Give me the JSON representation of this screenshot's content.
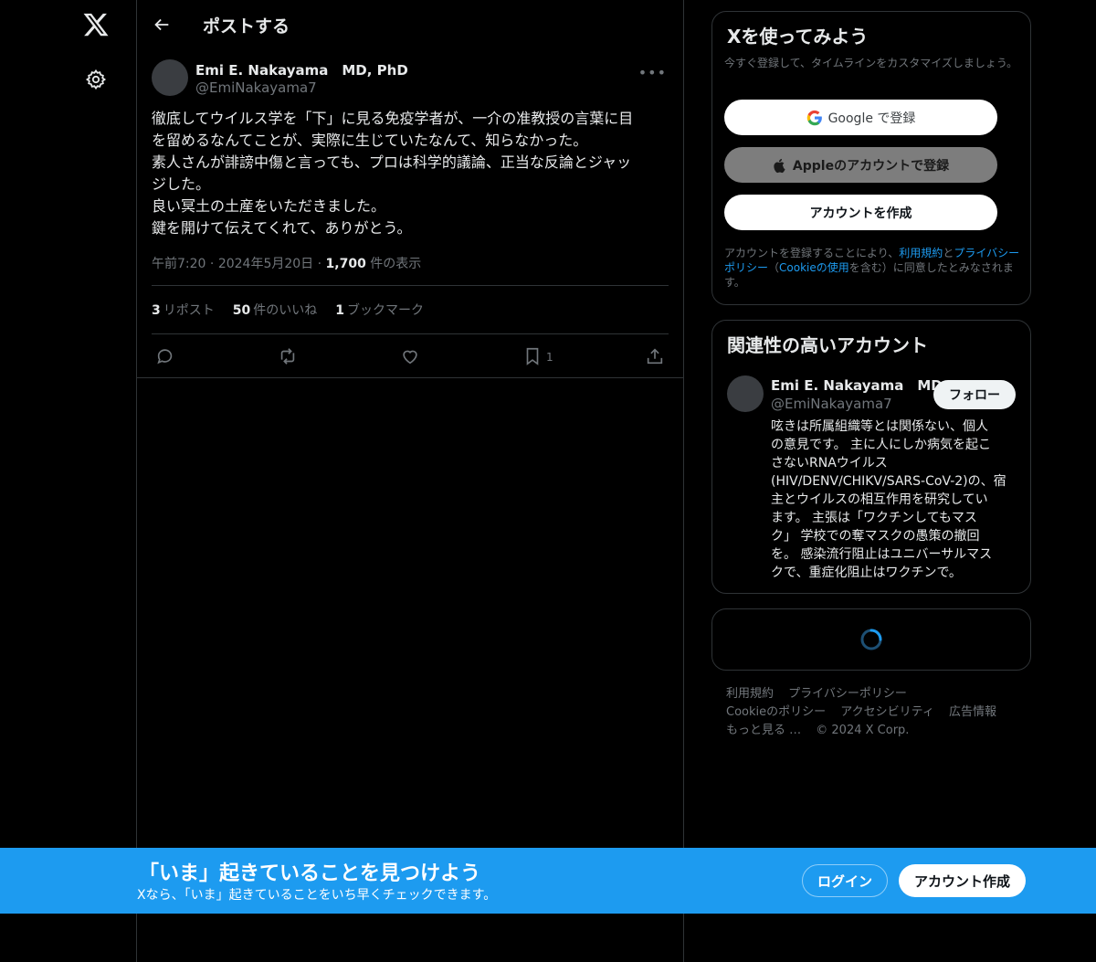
{
  "header": {
    "title": "ポストする"
  },
  "post": {
    "author_name": "Emi E. Nakayama　MD, PhD",
    "author_handle": "@EmiNakayama7",
    "more_label": "•••",
    "lines": [
      "徹底してウイルス学を「下」に見る免疫学者が、一介の准教授の言葉に目",
      "を留めるなんてことが、実際に生じていたなんて、知らなかった。",
      "素人さんが誹謗中傷と言っても、プロは科学的議論、正当な反論とジャッ",
      "ジした。",
      "良い冥土の土産をいただきました。",
      "鍵を開けて伝えてくれて、ありがとう。"
    ],
    "time": "午前7:20",
    "date": "2024年5月20日",
    "views_count": "1,700",
    "views_label": "件の表示",
    "reposts_count": "3",
    "reposts_label": "リポスト",
    "likes_count": "50",
    "likes_label": "件のいいね",
    "bookmarks_count": "1",
    "bookmarks_label": "ブックマーク",
    "bookmark_action_count": "1"
  },
  "signup_card": {
    "title": "Xを使ってみよう",
    "subtitle": "今すぐ登録して、タイムラインをカスタマイズしましょう。",
    "google_label": "Google で登録",
    "apple_label": "Appleのアカウントで登録",
    "create_label": "アカウントを作成",
    "legal_prefix": "アカウントを登録することにより、",
    "legal_terms": "利用規約",
    "legal_and": "と",
    "legal_privacy": "プライバシーポリシー",
    "legal_paren_open": "（",
    "legal_cookie": "Cookieの使用",
    "legal_suffix": "を含む）に同意したとみなされます。"
  },
  "related": {
    "title": "関連性の高いアカウント",
    "name": "Emi E. Nakayama　MD",
    "handle": "@EmiNakayama7",
    "follow_label": "フォロー",
    "bio_lines": [
      "呟きは所属組織等とは関係ない、個人",
      "の意見です。 主に人にしか病気を起こ",
      "さないRNAウイルス",
      "(HIV/DENV/CHIKV/SARS-CoV-2)の、宿",
      "主とウイルスの相互作用を研究してい",
      "ます。 主張は「ワクチンしてもマス",
      "ク」 学校での奪マスクの愚策の撤回",
      "を。 感染流行阻止はユニバーサルマス",
      "クで、重症化阻止はワクチンで。"
    ]
  },
  "footer": {
    "terms": "利用規約",
    "privacy": "プライバシーポリシー",
    "cookie": "Cookieのポリシー",
    "accessibility": "アクセシビリティ",
    "ads": "広告情報",
    "more": "もっと見る …",
    "copyright": "© 2024 X Corp."
  },
  "banner": {
    "title": "「いま」起きていることを見つけよう",
    "subtitle": "Xなら、「いま」起きていることをいち早くチェックできます。",
    "login_label": "ログイン",
    "signup_label": "アカウント作成"
  },
  "colors": {
    "accent": "#1d9bf0",
    "background": "#000000",
    "muted_text": "#71767b",
    "border": "#2f3336"
  }
}
